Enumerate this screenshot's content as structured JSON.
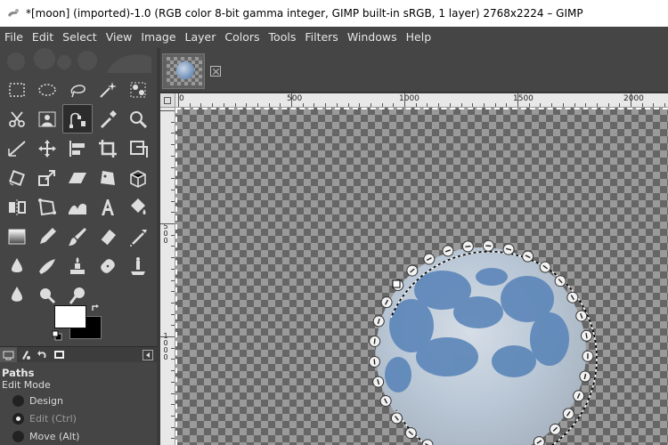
{
  "window": {
    "title": "*[moon] (imported)-1.0 (RGB color 8-bit gamma integer, GIMP built-in sRGB, 1 layer) 2768x2224 – GIMP"
  },
  "menu": [
    "File",
    "Edit",
    "Select",
    "View",
    "Image",
    "Layer",
    "Colors",
    "Tools",
    "Filters",
    "Windows",
    "Help"
  ],
  "toolbox": {
    "tools": [
      "rect-select-icon",
      "ellipse-select-icon",
      "lasso-icon",
      "fuzzy-select-icon",
      "select-by-color-icon",
      "scissors-icon",
      "foreground-select-icon",
      "paths-tool-icon",
      "color-picker-icon",
      "zoom-icon",
      "measure-icon",
      "move-icon",
      "align-icon",
      "crop-icon",
      "unified-transform-icon",
      "rotate-icon",
      "scale-icon",
      "shear-icon",
      "perspective-icon",
      "3d-transform-icon",
      "flip-icon",
      "cage-transform-icon",
      "warp-transform-icon",
      "text-icon",
      "bucket-fill-icon",
      "gradient-icon",
      "pencil-icon",
      "paintbrush-icon",
      "eraser-icon",
      "airbrush-icon",
      "ink-icon",
      "mypaint-brush-icon",
      "clone-icon",
      "heal-icon",
      "perspective-clone-icon",
      "blur-sharpen-icon",
      "smudge-icon",
      "dodge-burn-icon"
    ],
    "active_tool_index": 7,
    "foreground_color": "#ffffff",
    "background_color": "#000000"
  },
  "tool_options": {
    "title": "Paths",
    "section_label": "Edit Mode",
    "modes": [
      {
        "label": "Design",
        "checked": false,
        "enabled": true
      },
      {
        "label": "Edit (Ctrl)",
        "checked": true,
        "enabled": false
      },
      {
        "label": "Move (Alt)",
        "checked": false,
        "enabled": true
      }
    ]
  },
  "ruler": {
    "h_labels": [
      "0",
      "500",
      "1000",
      "1500",
      "2000"
    ],
    "v_labels": [
      "5\n0\n0",
      "1\n0\n0\n0"
    ]
  },
  "colors": {
    "selection_path": "#ffffff",
    "moon_blue": "#5b86b8",
    "moon_light": "#c8d3dd"
  }
}
